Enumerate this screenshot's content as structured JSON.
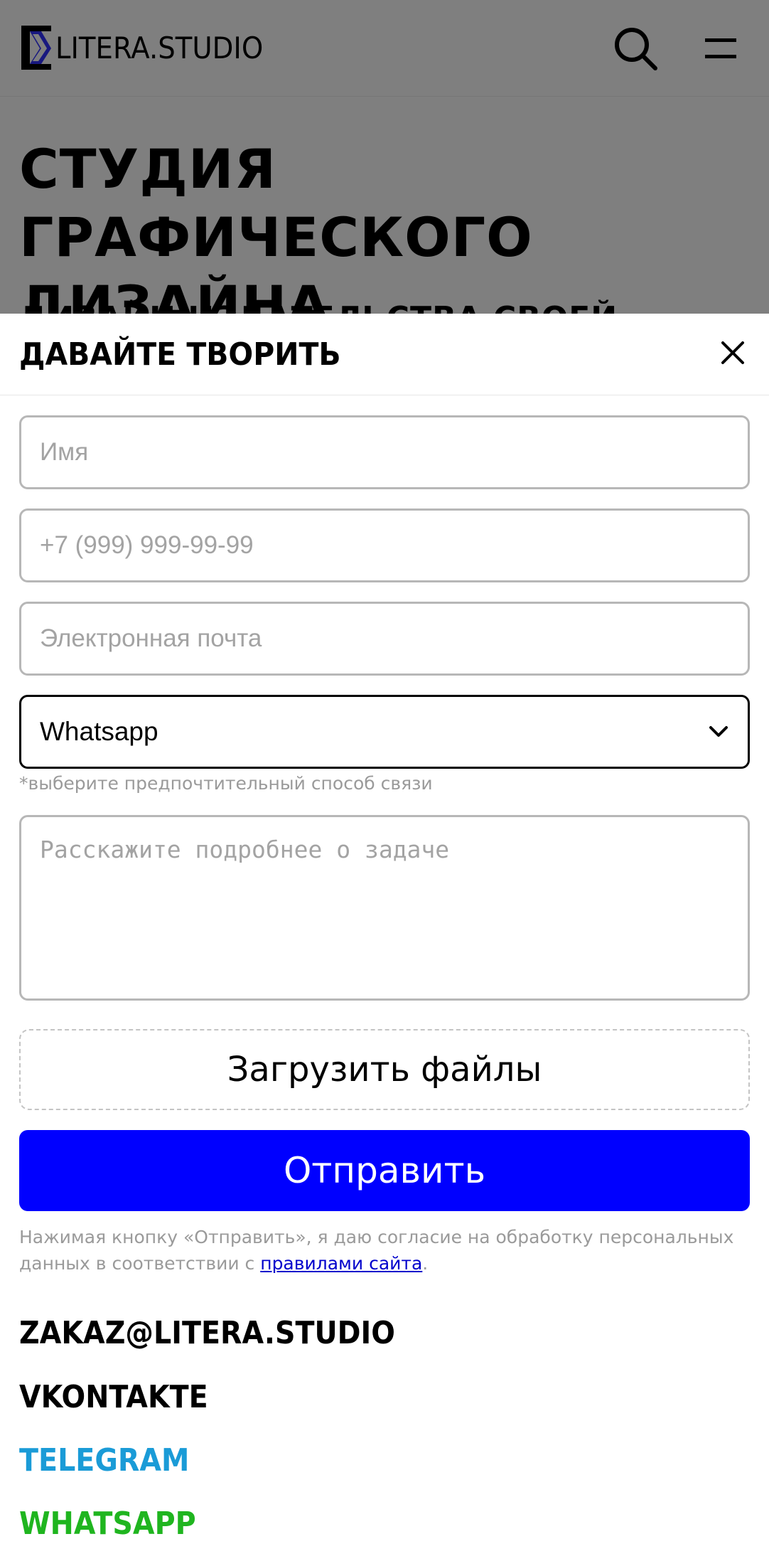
{
  "header": {
    "logo_text": "LITERA.STUDIO"
  },
  "hero": {
    "title": "СТУДИЯ ГРАФИЧЕСКОГО ДИЗАЙНА",
    "subtitle": "ДИЗАЙН ИЗДАТЕЛЬСТВА СВОЕЙ"
  },
  "modal": {
    "title": "ДАВАЙТЕ ТВОРИТЬ",
    "name_placeholder": "Имя",
    "phone_placeholder": "+7 (999) 999-99-99",
    "email_placeholder": "Электронная почта",
    "contact_method_selected": "Whatsapp",
    "contact_method_hint": "*выберите предпочтительный способ связи",
    "task_placeholder": "Расскажите подробнее о задаче",
    "upload_label": "Загрузить файлы",
    "submit_label": "Отправить",
    "consent_text": "Нажимая кнопку «Отправить», я даю согласие на обработку персональных данных в соответствии с ",
    "consent_link": "правилами сайта",
    "consent_end": "."
  },
  "contacts": {
    "email": "ZAKAZ@LITERA.STUDIO",
    "vk": "VKONTAKTE",
    "telegram": "TELEGRAM",
    "whatsapp": "WHATSAPP"
  },
  "colors": {
    "accent_button": "#0000ff",
    "telegram": "#1a9bd7",
    "whatsapp": "#1fb51f",
    "overlay": "rgba(0,0,0,0.5)"
  },
  "icons": {
    "logo": "litera-logo-icon",
    "search": "search-icon",
    "menu": "hamburger-menu-icon",
    "close": "close-icon",
    "dropdown": "chevron-down-icon"
  }
}
